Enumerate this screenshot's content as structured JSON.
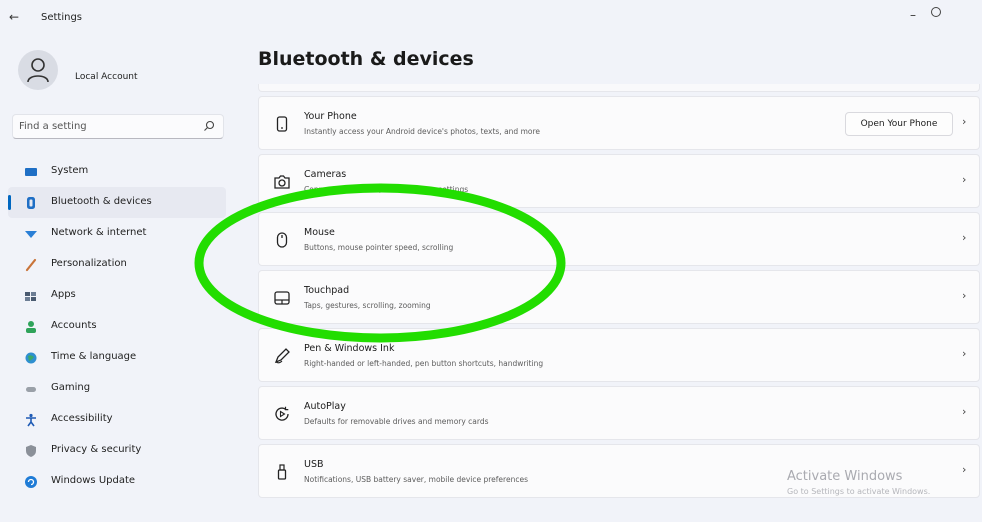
{
  "window": {
    "back_glyph": "←",
    "title": "Settings",
    "minimize_glyph": "–"
  },
  "account": {
    "name": "Local Account"
  },
  "search": {
    "placeholder": "Find a setting"
  },
  "sidebar": {
    "items": [
      {
        "label": "System",
        "icon": "system-icon",
        "selected": false
      },
      {
        "label": "Bluetooth & devices",
        "icon": "bluetooth-icon",
        "selected": true
      },
      {
        "label": "Network & internet",
        "icon": "network-icon",
        "selected": false
      },
      {
        "label": "Personalization",
        "icon": "personalization-icon",
        "selected": false
      },
      {
        "label": "Apps",
        "icon": "apps-icon",
        "selected": false
      },
      {
        "label": "Accounts",
        "icon": "accounts-icon",
        "selected": false
      },
      {
        "label": "Time & language",
        "icon": "time-language-icon",
        "selected": false
      },
      {
        "label": "Gaming",
        "icon": "gaming-icon",
        "selected": false
      },
      {
        "label": "Accessibility",
        "icon": "accessibility-icon",
        "selected": false
      },
      {
        "label": "Privacy & security",
        "icon": "privacy-icon",
        "selected": false
      },
      {
        "label": "Windows Update",
        "icon": "windows-update-icon",
        "selected": false
      }
    ]
  },
  "main": {
    "title": "Bluetooth & devices",
    "cards": [
      {
        "title": "Your Phone",
        "description": "Instantly access your Android device's photos, texts, and more",
        "icon": "phone-icon",
        "button": "Open Your Phone",
        "chevron": "›"
      },
      {
        "title": "Cameras",
        "description": "Connected cameras, default image settings",
        "icon": "camera-icon",
        "chevron": "›"
      },
      {
        "title": "Mouse",
        "description": "Buttons, mouse pointer speed, scrolling",
        "icon": "mouse-icon",
        "chevron": "›"
      },
      {
        "title": "Touchpad",
        "description": "Taps, gestures, scrolling, zooming",
        "icon": "touchpad-icon",
        "chevron": "›"
      },
      {
        "title": "Pen & Windows Ink",
        "description": "Right-handed or left-handed, pen button shortcuts, handwriting",
        "icon": "pen-icon",
        "chevron": "›"
      },
      {
        "title": "AutoPlay",
        "description": "Defaults for removable drives and memory cards",
        "icon": "autoplay-icon",
        "chevron": "›"
      },
      {
        "title": "USB",
        "description": "Notifications, USB battery saver, mobile device preferences",
        "icon": "usb-icon",
        "chevron": "›"
      }
    ]
  },
  "watermark": {
    "title": "Activate Windows",
    "subtitle": "Go to Settings to activate Windows."
  },
  "colors": {
    "accent": "#0067c0",
    "annotation": "#22dd00",
    "background": "#f1f3f9",
    "card": "#fbfbfc"
  }
}
